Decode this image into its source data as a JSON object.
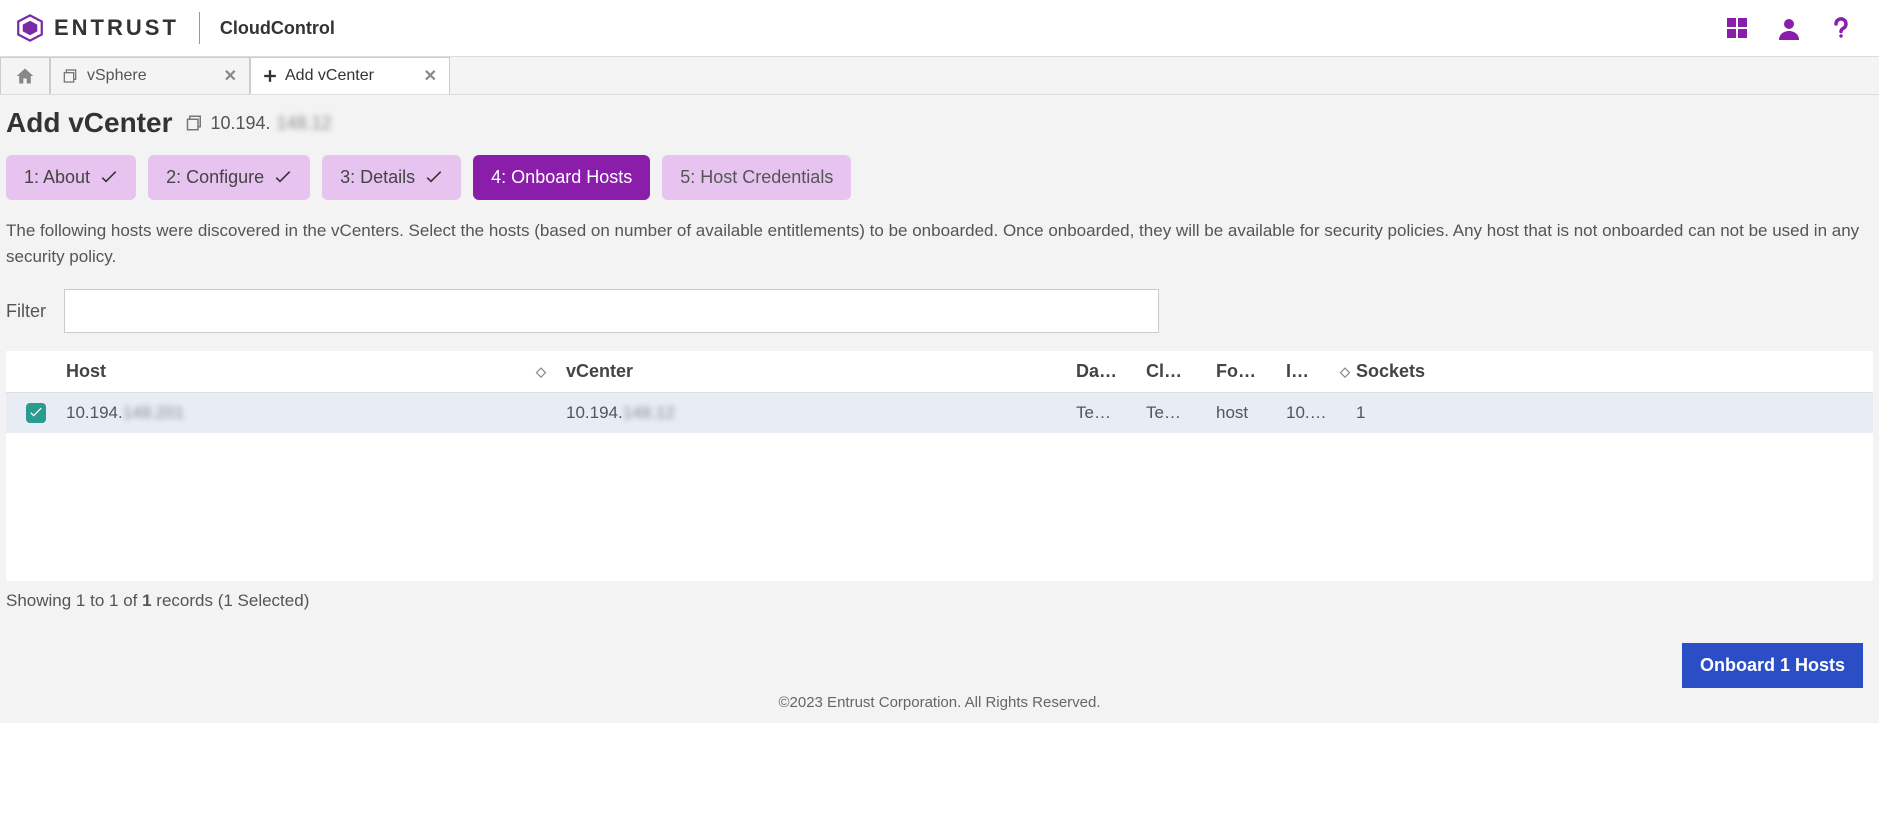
{
  "brand": "ENTRUST",
  "product": "CloudControl",
  "tabs": {
    "vsphere": "vSphere",
    "addvc": "Add vCenter"
  },
  "page": {
    "title": "Add vCenter",
    "ip_visible": "10.194.",
    "ip_blurred": "148.12"
  },
  "wizard": {
    "about": "1: About",
    "configure": "2: Configure",
    "details": "3: Details",
    "onboard": "4: Onboard Hosts",
    "creds": "5: Host Credentials"
  },
  "description": "The following hosts were discovered in the vCenters. Select the hosts (based on number of available entitlements) to be onboarded. Once onboarded, they will be available for security policies. Any host that is not onboarded can not be used in any security policy.",
  "filter": {
    "label": "Filter",
    "value": ""
  },
  "columns": {
    "host": "Host",
    "vcenter": "vCenter",
    "da": "Da…",
    "cl": "Cl…",
    "fo": "Fo…",
    "ip": "I…",
    "sockets": "Sockets"
  },
  "rows": [
    {
      "checked": true,
      "host_visible": "10.194.",
      "host_blurred": "148.201",
      "vc_visible": "10.194.",
      "vc_blurred": "148.12",
      "da": "Te…",
      "cl": "Te…",
      "fo": "host",
      "ip": "10.…",
      "sockets": "1"
    }
  ],
  "status": {
    "prefix": "Showing 1 to 1 of ",
    "total": "1",
    "suffix": " records (1 Selected)"
  },
  "cta": "Onboard 1 Hosts",
  "footer": "©2023 Entrust Corporation. All Rights Reserved."
}
